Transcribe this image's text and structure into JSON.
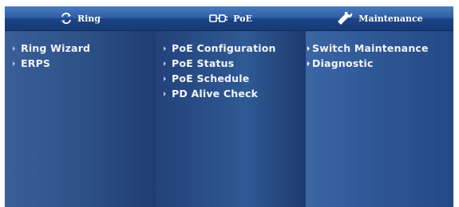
{
  "menu": {
    "columns": [
      {
        "title": "Ring",
        "icon": "ring-icon",
        "items": [
          "Ring Wizard",
          "ERPS"
        ]
      },
      {
        "title": "PoE",
        "icon": "poe-plug-icon",
        "items": [
          "PoE Configuration",
          "PoE Status",
          "PoE Schedule",
          "PD Alive Check"
        ]
      },
      {
        "title": "Maintenance",
        "icon": "wrench-icon",
        "items": [
          "Switch Maintenance",
          "Diagnostic"
        ]
      }
    ]
  },
  "colors": {
    "header_gradient_top": "#4a7bc0",
    "header_gradient_bottom": "#183a76",
    "panel_blue": "#2d5088",
    "text": "#f2f5fa"
  }
}
